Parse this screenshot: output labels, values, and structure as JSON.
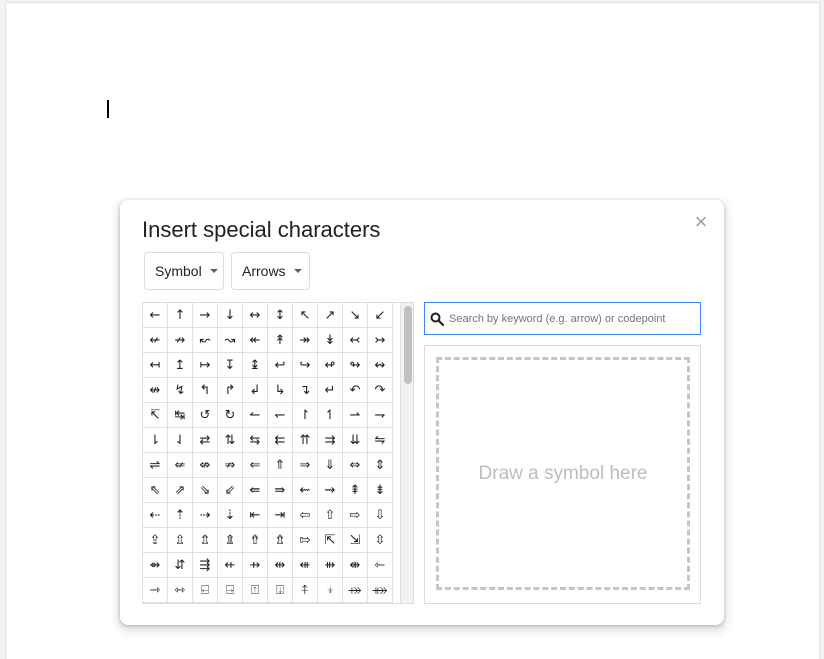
{
  "dialog": {
    "title": "Insert special characters",
    "close_glyph": "×",
    "category_dropdown": "Symbol",
    "subcategory_dropdown": "Arrows",
    "search_placeholder": "Search by keyword (e.g. arrow) or codepoint",
    "draw_label": "Draw a symbol here"
  },
  "symbols": [
    "←",
    "↑",
    "→",
    "↓",
    "↔",
    "↕",
    "↖",
    "↗",
    "↘",
    "↙",
    "↚",
    "↛",
    "↜",
    "↝",
    "↞",
    "↟",
    "↠",
    "↡",
    "↢",
    "↣",
    "↤",
    "↥",
    "↦",
    "↧",
    "↨",
    "↩",
    "↪",
    "↫",
    "↬",
    "↭",
    "↮",
    "↯",
    "↰",
    "↱",
    "↲",
    "↳",
    "↴",
    "↵",
    "↶",
    "↷",
    "↸",
    "↹",
    "↺",
    "↻",
    "↼",
    "↽",
    "↾",
    "↿",
    "⇀",
    "⇁",
    "⇂",
    "⇃",
    "⇄",
    "⇅",
    "⇆",
    "⇇",
    "⇈",
    "⇉",
    "⇊",
    "⇋",
    "⇌",
    "⇍",
    "⇎",
    "⇏",
    "⇐",
    "⇑",
    "⇒",
    "⇓",
    "⇔",
    "⇕",
    "⇖",
    "⇗",
    "⇘",
    "⇙",
    "⇚",
    "⇛",
    "⇜",
    "⇝",
    "⇞",
    "⇟",
    "⇠",
    "⇡",
    "⇢",
    "⇣",
    "⇤",
    "⇥",
    "⇦",
    "⇧",
    "⇨",
    "⇩",
    "⇪",
    "⇫",
    "⇬",
    "⇭",
    "⇮",
    "⇯",
    "⇰",
    "⇱",
    "⇲",
    "⇳",
    "⇴",
    "⇵",
    "⇶",
    "⇷",
    "⇸",
    "⇹",
    "⇺",
    "⇻",
    "⇼",
    "⇽",
    "⇾",
    "⇿",
    "⍇",
    "⍈",
    "⍐",
    "⍗",
    "⍏",
    "⍖",
    "⤀",
    "⤁"
  ],
  "colors": {
    "accent": "#4285f4",
    "border": "#dadce0",
    "text": "#202124"
  }
}
